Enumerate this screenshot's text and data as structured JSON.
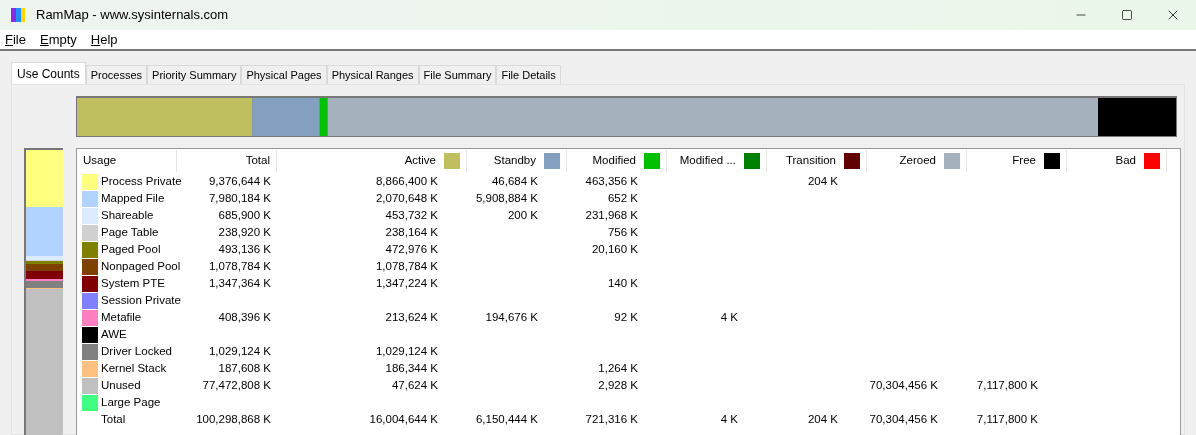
{
  "window": {
    "title": "RamMap - www.sysinternals.com"
  },
  "menu": [
    "File",
    "Empty",
    "Help"
  ],
  "tabs": [
    {
      "label": "Use Counts",
      "selected": true
    },
    {
      "label": "Processes",
      "selected": false
    },
    {
      "label": "Priority Summary",
      "selected": false
    },
    {
      "label": "Physical Pages",
      "selected": false
    },
    {
      "label": "Physical Ranges",
      "selected": false
    },
    {
      "label": "File Summary",
      "selected": false
    },
    {
      "label": "File Details",
      "selected": false
    }
  ],
  "table": {
    "columns": [
      {
        "label": "Usage"
      },
      {
        "label": "Total"
      },
      {
        "label": "Active",
        "color": "#bfbf60"
      },
      {
        "label": "Standby",
        "color": "#84a0c0"
      },
      {
        "label": "Modified",
        "color": "#00c000"
      },
      {
        "label": "Modified ...",
        "color": "#008000"
      },
      {
        "label": "Transition",
        "color": "#600000"
      },
      {
        "label": "Zeroed",
        "color": "#a5b1bd"
      },
      {
        "label": "Free",
        "color": "#000000"
      },
      {
        "label": "Bad",
        "color": "#ff0000"
      }
    ],
    "rows": [
      {
        "kind": "usage",
        "color": "#ffff80",
        "cells": [
          "Process Private",
          "9,376,644 K",
          "8,866,400 K",
          "46,684 K",
          "463,356 K",
          null,
          "204 K",
          null,
          null,
          null
        ]
      },
      {
        "kind": "usage",
        "color": "#b0d4ff",
        "cells": [
          "Mapped File",
          "7,980,184 K",
          "2,070,648 K",
          "5,908,884 K",
          "652 K",
          null,
          null,
          null,
          null,
          null
        ]
      },
      {
        "kind": "usage",
        "color": "#dcebff",
        "cells": [
          "Shareable",
          "685,900 K",
          "453,732 K",
          "200 K",
          "231,968 K",
          null,
          null,
          null,
          null,
          null
        ]
      },
      {
        "kind": "usage",
        "color": "#d0d0d0",
        "cells": [
          "Page Table",
          "238,920 K",
          "238,164 K",
          null,
          "756 K",
          null,
          null,
          null,
          null,
          null
        ]
      },
      {
        "kind": "usage",
        "color": "#808000",
        "cells": [
          "Paged Pool",
          "493,136 K",
          "472,976 K",
          null,
          "20,160 K",
          null,
          null,
          null,
          null,
          null
        ]
      },
      {
        "kind": "usage",
        "color": "#804000",
        "cells": [
          "Nonpaged Pool",
          "1,078,784 K",
          "1,078,784 K",
          null,
          null,
          null,
          null,
          null,
          null,
          null
        ]
      },
      {
        "kind": "usage",
        "color": "#800000",
        "cells": [
          "System PTE",
          "1,347,364 K",
          "1,347,224 K",
          null,
          "140 K",
          null,
          null,
          null,
          null,
          null
        ]
      },
      {
        "kind": "usage",
        "color": "#8080ff",
        "cells": [
          "Session Private",
          null,
          null,
          null,
          null,
          null,
          null,
          null,
          null,
          null
        ]
      },
      {
        "kind": "usage",
        "color": "#ff80c0",
        "cells": [
          "Metafile",
          "408,396 K",
          "213,624 K",
          "194,676 K",
          "92 K",
          "4 K",
          null,
          null,
          null,
          null
        ]
      },
      {
        "kind": "usage",
        "color": "#000000",
        "cells": [
          "AWE",
          null,
          null,
          null,
          null,
          null,
          null,
          null,
          null,
          null
        ]
      },
      {
        "kind": "usage",
        "color": "#808080",
        "cells": [
          "Driver Locked",
          "1,029,124 K",
          "1,029,124 K",
          null,
          null,
          null,
          null,
          null,
          null,
          null
        ]
      },
      {
        "kind": "usage",
        "color": "#ffc080",
        "cells": [
          "Kernel Stack",
          "187,608 K",
          "186,344 K",
          null,
          "1,264 K",
          null,
          null,
          null,
          null,
          null
        ]
      },
      {
        "kind": "usage",
        "color": "#c0c0c0",
        "cells": [
          "Unused",
          "77,472,808 K",
          "47,624 K",
          null,
          "2,928 K",
          null,
          null,
          "70,304,456 K",
          "7,117,800 K",
          null
        ]
      },
      {
        "kind": "usage",
        "color": "#40ff80",
        "cells": [
          "Large Page",
          null,
          null,
          null,
          null,
          null,
          null,
          null,
          null,
          null
        ]
      },
      {
        "kind": "total",
        "cells": [
          "Total",
          "100,298,868 K",
          "16,004,644 K",
          "6,150,444 K",
          "721,316 K",
          "4 K",
          "204 K",
          "70,304,456 K",
          "7,117,800 K",
          null
        ]
      }
    ]
  }
}
